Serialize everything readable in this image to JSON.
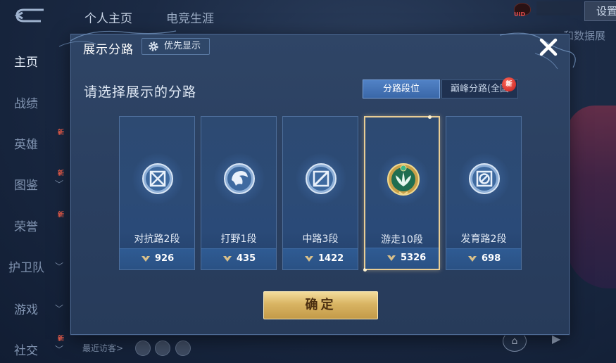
{
  "top_tabs": [
    "个人主页",
    "电竞生涯"
  ],
  "uid_label": "UID",
  "settings_label": "设置",
  "bg_right_text": "和数据展",
  "side_nav": [
    {
      "label": "主页",
      "active": true,
      "chevron": false,
      "new": false
    },
    {
      "label": "战绩",
      "active": false,
      "chevron": false,
      "new": false
    },
    {
      "label": "英雄",
      "active": false,
      "chevron": false,
      "new": true
    },
    {
      "label": "图鉴",
      "active": false,
      "chevron": true,
      "new": true
    },
    {
      "label": "荣誉",
      "active": false,
      "chevron": false,
      "new": true
    },
    {
      "label": "护卫队",
      "active": false,
      "chevron": true,
      "new": false
    },
    {
      "label": "游戏",
      "active": false,
      "chevron": true,
      "new": false
    },
    {
      "label": "社交",
      "active": false,
      "chevron": true,
      "new": true
    }
  ],
  "new_tag": "新",
  "visitors_label": "最近访客>",
  "modal": {
    "title": "展示分路",
    "priority_label": "优先显示",
    "subtitle": "请选择展示的分路",
    "segments": [
      {
        "label": "分路段位",
        "active": true
      },
      {
        "label": "巅峰分路(全国",
        "active": false,
        "new": "新"
      }
    ],
    "lanes": [
      {
        "name": "对抗路2段",
        "score": "926",
        "selected": false,
        "icon": "clash-lane-emblem-icon"
      },
      {
        "name": "打野1段",
        "score": "435",
        "selected": false,
        "icon": "jungle-emblem-icon"
      },
      {
        "name": "中路3段",
        "score": "1422",
        "selected": false,
        "icon": "mid-lane-emblem-icon"
      },
      {
        "name": "游走10段",
        "score": "5326",
        "selected": true,
        "icon": "roam-emblem-icon"
      },
      {
        "name": "发育路2段",
        "score": "698",
        "selected": false,
        "icon": "farm-lane-emblem-icon"
      }
    ],
    "confirm_label": "确定"
  },
  "colors": {
    "accent_blue": "#3a67a8",
    "gold": "#d9b463",
    "selected_border": "#e8cd95",
    "new_red": "#c21c1c"
  }
}
